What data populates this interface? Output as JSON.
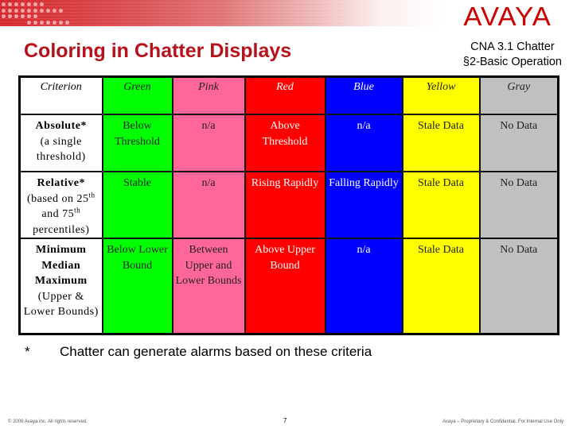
{
  "slide": {
    "title": "Coloring in Chatter Displays",
    "subtitle_line1": "CNA 3.1 Chatter",
    "subtitle_line2": "§2-Basic Operation",
    "logo_text": "AVAYA",
    "brand_color": "#cc0000",
    "title_color": "#b5121b"
  },
  "table": {
    "criterion_header": "Criterion",
    "columns": [
      {
        "label": "Green",
        "color": "#00ff00"
      },
      {
        "label": "Pink",
        "color": "#ff6699"
      },
      {
        "label": "Red",
        "color": "#ff0000"
      },
      {
        "label": "Blue",
        "color": "#0000ff"
      },
      {
        "label": "Yellow",
        "color": "#ffff00"
      },
      {
        "label": "Gray",
        "color": "#c0c0c0"
      }
    ],
    "rows": [
      {
        "name": "Absolute*",
        "desc": "(a single threshold)",
        "cells": [
          "Below Threshold",
          "n/a",
          "Above Threshold",
          "n/a",
          "Stale Data",
          "No Data"
        ]
      },
      {
        "name": "Relative*",
        "desc_pre": "(based on 25",
        "desc_sup1": "th",
        "desc_mid": " and 75",
        "desc_sup2": "th",
        "desc_post": " percentiles)",
        "cells": [
          "Stable",
          "n/a",
          "Rising Rapidly",
          "Falling Rapidly",
          "Stale Data",
          "No Data"
        ]
      },
      {
        "name": "Minimum Median Maximum",
        "desc": "(Upper & Lower Bounds)",
        "cells": [
          "Below Lower Bound",
          "Between Upper and Lower Bounds",
          "Above Upper Bound",
          "n/a",
          "Stale Data",
          "No Data"
        ]
      }
    ]
  },
  "footnote": {
    "marker": "*",
    "text": "Chatter can generate alarms based on these criteria"
  },
  "footer": {
    "copyright": "© 2006 Avaya Inc. All rights reserved.",
    "page_number": "7",
    "confidential": "Avaya – Proprietary & Confidential. For Internal Use Only"
  }
}
